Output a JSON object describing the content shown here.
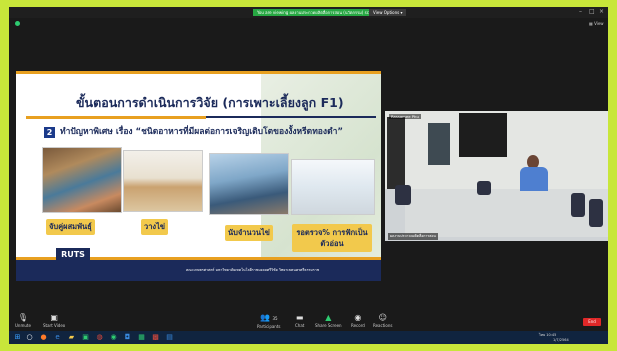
{
  "window": {
    "share_banner": "You are viewing ผลงานประกวดผลิตสื่อการสอน (นวัตกรรม) screen",
    "view_options": "View Options ▾",
    "view_label": "View"
  },
  "slide": {
    "title": "ขั้นตอนการดำเนินการวิจัย (การเพาะเลี้ยงลูก F1)",
    "step_number": "2",
    "step_text": "ทำปัญหาพิเศษ เรื่อง “ชนิดอาหารที่มีผลต่อการเจริญเติบโตของงั้งหรีดทองดำ”",
    "photo_labels": [
      "จับคู่ผสมพันธุ์",
      "วางไข่",
      "นับจำนวนไข่",
      "รอตรวจ% การฟักเป็นตัวอ่อน"
    ],
    "logo_text": "RUTS",
    "footer": "คณะเกษตรศาสตร์ มหาวิทยาลัยเทคโนโลยีราชมงคลศรีวิชัย วิทยาเขตนครศรีธรรมราช"
  },
  "video": {
    "top_name": "Rassamee Phu",
    "name_tag": "ผลงานประกวดผลิตสื่อการสอน"
  },
  "controls": {
    "unmute": "Unmute",
    "start_video": "Start Video",
    "participants": "Participants",
    "participants_count": "35",
    "chat": "Chat",
    "share_screen": "Share Screen",
    "record": "Record",
    "reactions": "Reactions",
    "end": "End"
  },
  "taskbar": {
    "time": "10:45",
    "date": "1/7/2564",
    "lang": "ไทย"
  }
}
